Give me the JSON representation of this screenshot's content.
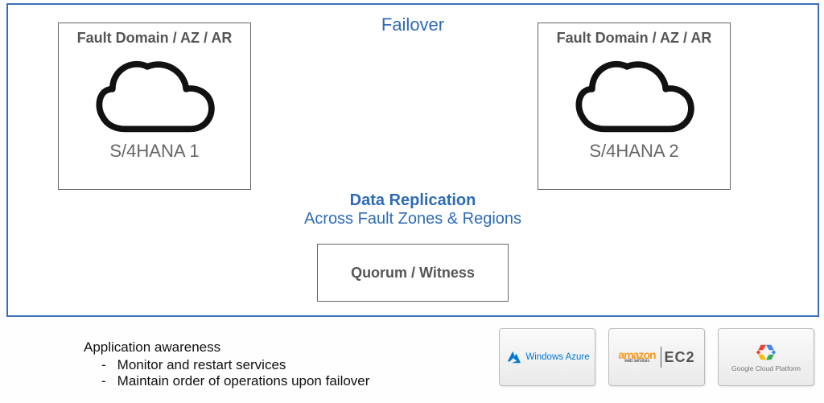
{
  "failover_title": "Failover",
  "left_domain": {
    "title": "Fault Domain / AZ / AR",
    "instance": "S/4HANA 1"
  },
  "right_domain": {
    "title": "Fault Domain / AZ / AR",
    "instance": "S/4HANA 2"
  },
  "data_replication": {
    "title": "Data Replication",
    "subtitle": "Across Fault Zones & Regions"
  },
  "quorum": {
    "title": "Quorum / Witness"
  },
  "awareness": {
    "heading": "Application awareness",
    "bullets": [
      "Monitor and restart services",
      "Maintain order of operations upon failover"
    ]
  },
  "providers": {
    "azure": "Windows Azure",
    "aws_top": "amazon",
    "aws_sub": "web services",
    "aws_ec2": "EC2",
    "gcp": "Google Cloud Platform"
  }
}
